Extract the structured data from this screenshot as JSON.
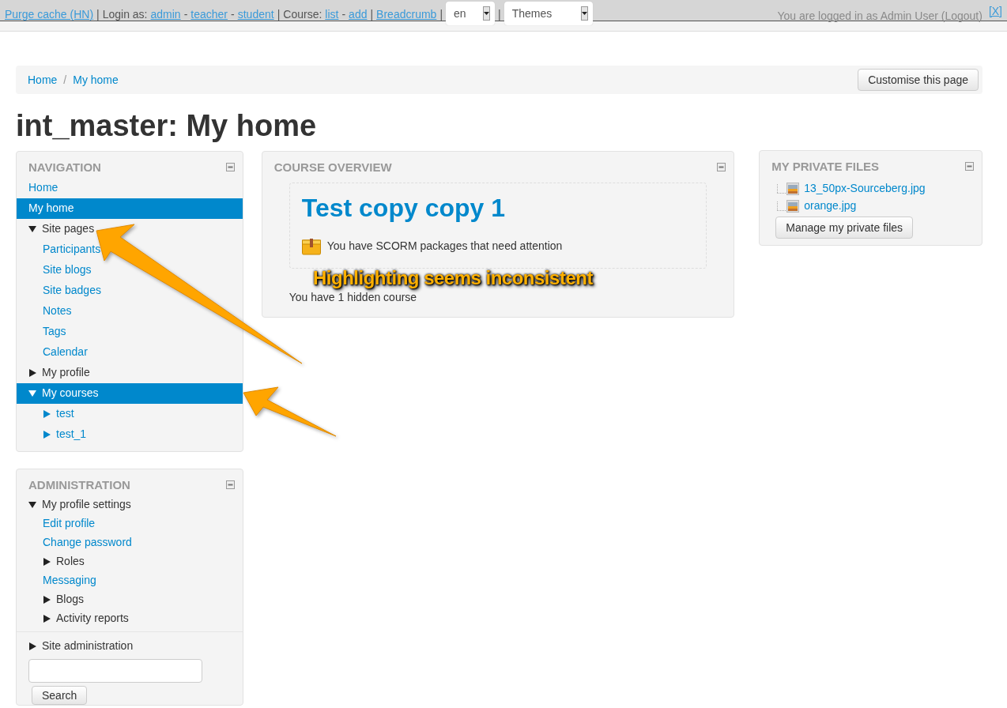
{
  "top_bar": {
    "segments": [
      {
        "kind": "link",
        "text": "Purge cache (HN)"
      },
      {
        "kind": "text",
        "text": "|"
      },
      {
        "kind": "text",
        "text": "Login as:"
      },
      {
        "kind": "link",
        "text": "admin"
      },
      {
        "kind": "text",
        "text": "-"
      },
      {
        "kind": "link",
        "text": "teacher"
      },
      {
        "kind": "text",
        "text": "-"
      },
      {
        "kind": "link",
        "text": "student"
      },
      {
        "kind": "text",
        "text": "|"
      },
      {
        "kind": "text",
        "text": "Course:"
      },
      {
        "kind": "link",
        "text": "list"
      },
      {
        "kind": "text",
        "text": "-"
      },
      {
        "kind": "link",
        "text": "add"
      },
      {
        "kind": "text",
        "text": "|"
      },
      {
        "kind": "link",
        "text": "Breadcrumb"
      },
      {
        "kind": "text",
        "text": "|"
      },
      {
        "kind": "select",
        "text": "en"
      },
      {
        "kind": "text",
        "text": "|"
      },
      {
        "kind": "select",
        "text": "Themes"
      }
    ],
    "login_info": "You are logged in as Admin User (Logout)",
    "close": "[X]"
  },
  "breadcrumb": {
    "separator": "/",
    "items": [
      {
        "label": "Home"
      },
      {
        "label": "My home"
      }
    ],
    "button": "Customise this page"
  },
  "page_title": "int_master: My home",
  "navigation": {
    "title": "NAVIGATION",
    "items": [
      {
        "label": "Home",
        "kind": "link",
        "selected": false
      },
      {
        "label": "My home",
        "kind": "link",
        "selected": true
      },
      {
        "label": "Site pages",
        "kind": "branch",
        "expanded": true,
        "selected": false,
        "children": [
          {
            "label": "Participants",
            "kind": "link",
            "selected": false
          },
          {
            "label": "Site blogs",
            "kind": "link",
            "selected": false
          },
          {
            "label": "Site badges",
            "kind": "link",
            "selected": false
          },
          {
            "label": "Notes",
            "kind": "link",
            "selected": false
          },
          {
            "label": "Tags",
            "kind": "link",
            "selected": false
          },
          {
            "label": "Calendar",
            "kind": "link",
            "selected": false
          }
        ]
      },
      {
        "label": "My profile",
        "kind": "branch",
        "expanded": false,
        "selected": false
      },
      {
        "label": "My courses",
        "kind": "branch",
        "expanded": true,
        "selected": true,
        "children": [
          {
            "label": "test",
            "kind": "branch-link",
            "expanded": false,
            "selected": false
          },
          {
            "label": "test_1",
            "kind": "branch-link",
            "expanded": false,
            "selected": false
          }
        ]
      }
    ]
  },
  "administration": {
    "title": "ADMINISTRATION",
    "items": [
      {
        "label": "My profile settings",
        "kind": "branch",
        "expanded": true,
        "selected": false,
        "children": [
          {
            "label": "Edit profile",
            "kind": "link",
            "selected": false
          },
          {
            "label": "Change password",
            "kind": "link",
            "selected": false
          },
          {
            "label": "Roles",
            "kind": "branch",
            "expanded": false,
            "selected": false
          },
          {
            "label": "Messaging",
            "kind": "link",
            "selected": false
          },
          {
            "label": "Blogs",
            "kind": "branch",
            "expanded": false,
            "selected": false
          },
          {
            "label": "Activity reports",
            "kind": "branch",
            "expanded": false,
            "selected": false
          }
        ]
      }
    ],
    "footer_items": [
      {
        "label": "Site administration",
        "kind": "branch",
        "expanded": false,
        "selected": false
      }
    ],
    "search_button": "Search"
  },
  "course_overview": {
    "title": "COURSE OVERVIEW",
    "course": "Test copy copy 1",
    "notice": "You have SCORM packages that need attention",
    "hidden_note": "You have 1 hidden course"
  },
  "private_files": {
    "title": "MY PRIVATE FILES",
    "files": [
      "13_50px-Sourceberg.jpg",
      "orange.jpg"
    ],
    "button": "Manage my private files"
  },
  "annotation": {
    "text": "Highlighting seems inconsistent"
  }
}
